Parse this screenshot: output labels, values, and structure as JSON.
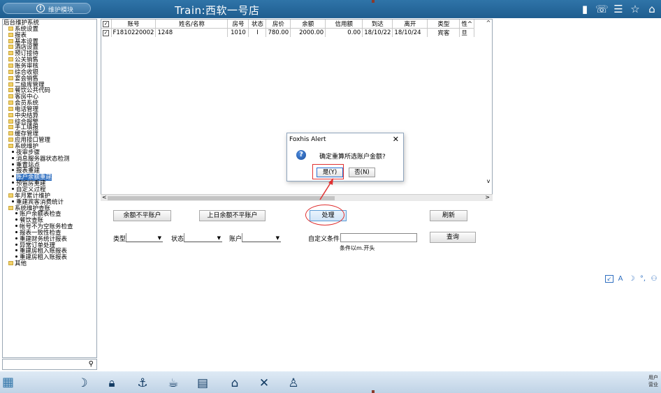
{
  "topbar": {
    "module_label": "维护模块",
    "title": "Train:西软一号店",
    "icons": [
      "signal-icon",
      "phone-icon",
      "menu-icon",
      "star-icon",
      "home-icon"
    ]
  },
  "tree": {
    "items": [
      {
        "label": "后台维护系统",
        "kind": "root"
      },
      {
        "label": "系统设置",
        "kind": "folder"
      },
      {
        "label": "报表",
        "kind": "folder"
      },
      {
        "label": "基本设置",
        "kind": "folder"
      },
      {
        "label": "酒店设置",
        "kind": "folder"
      },
      {
        "label": "预订接待",
        "kind": "folder"
      },
      {
        "label": "公关销售",
        "kind": "folder"
      },
      {
        "label": "账务审核",
        "kind": "folder"
      },
      {
        "label": "综合收银",
        "kind": "folder"
      },
      {
        "label": "宴会销售",
        "kind": "folder"
      },
      {
        "label": "二级库管理",
        "kind": "folder"
      },
      {
        "label": "餐饮公共代码",
        "kind": "folder"
      },
      {
        "label": "客房中心",
        "kind": "folder"
      },
      {
        "label": "会员系统",
        "kind": "folder"
      },
      {
        "label": "电话管理",
        "kind": "folder"
      },
      {
        "label": "中央结算",
        "kind": "folder"
      },
      {
        "label": "综合报警",
        "kind": "folder"
      },
      {
        "label": "手工填报",
        "kind": "folder"
      },
      {
        "label": "缓存管理",
        "kind": "folder"
      },
      {
        "label": "应用接口管理",
        "kind": "folder"
      },
      {
        "label": "系统维护",
        "kind": "folder"
      },
      {
        "label": "夜审步骤",
        "kind": "leaf"
      },
      {
        "label": "消息服务器状态检测",
        "kind": "leaf"
      },
      {
        "label": "重置站点",
        "kind": "leaf"
      },
      {
        "label": "报表重建",
        "kind": "leaf"
      },
      {
        "label": "账户余额重建",
        "kind": "leaf",
        "selected": true
      },
      {
        "label": "预留房重建",
        "kind": "leaf"
      },
      {
        "label": "自定义过程",
        "kind": "leaf"
      },
      {
        "label": "年月累计维护",
        "kind": "folder"
      },
      {
        "label": "重建宾客消费统计",
        "kind": "leaf"
      },
      {
        "label": "系统维护查账",
        "kind": "folder"
      },
      {
        "label": "账户余额表检查",
        "kind": "leaf2"
      },
      {
        "label": "餐饮查账",
        "kind": "leaf2"
      },
      {
        "label": "帐号不为空账务检查",
        "kind": "leaf2"
      },
      {
        "label": "报表一致性检查",
        "kind": "leaf2"
      },
      {
        "label": "重建财务统计报表",
        "kind": "leaf2"
      },
      {
        "label": "异常订单处理",
        "kind": "leaf2"
      },
      {
        "label": "重建房租入账报表",
        "kind": "leaf2"
      },
      {
        "label": "重建房租入账报表",
        "kind": "leaf2"
      },
      {
        "label": "其他",
        "kind": "folder"
      }
    ]
  },
  "grid": {
    "columns": [
      "",
      "账号",
      "姓名/名称",
      "房号",
      "状态",
      "房价",
      "余额",
      "信用额",
      "到达",
      "离开",
      "类型",
      "性^"
    ],
    "rows": [
      [
        "✓",
        "F1810220002",
        "1248",
        "1010",
        "I",
        "780.00",
        "2000.00",
        "0.00",
        "18/10/22",
        "18/10/24",
        "宾客",
        "旦"
      ]
    ]
  },
  "buttons": {
    "unbalanced": "余额不平账户",
    "prev_unbalanced": "上日余额不平账户",
    "process": "处理",
    "refresh": "刷新",
    "query": "查询"
  },
  "filters": {
    "type_label": "类型",
    "status_label": "状态",
    "account_label": "账户",
    "custom_label": "自定义条件",
    "custom_hint": "条件以m.开头"
  },
  "dialog": {
    "title": "Foxhis Alert",
    "message": "确定重算所选账户金额?",
    "yes": "是(Y)",
    "no": "否(N)"
  },
  "bottom": {
    "user_line1": "用户",
    "user_line2": "营业"
  },
  "colors": {
    "topbar": "#2f74a8",
    "annotation_red": "#e03131",
    "selection": "#2f6fc0"
  }
}
